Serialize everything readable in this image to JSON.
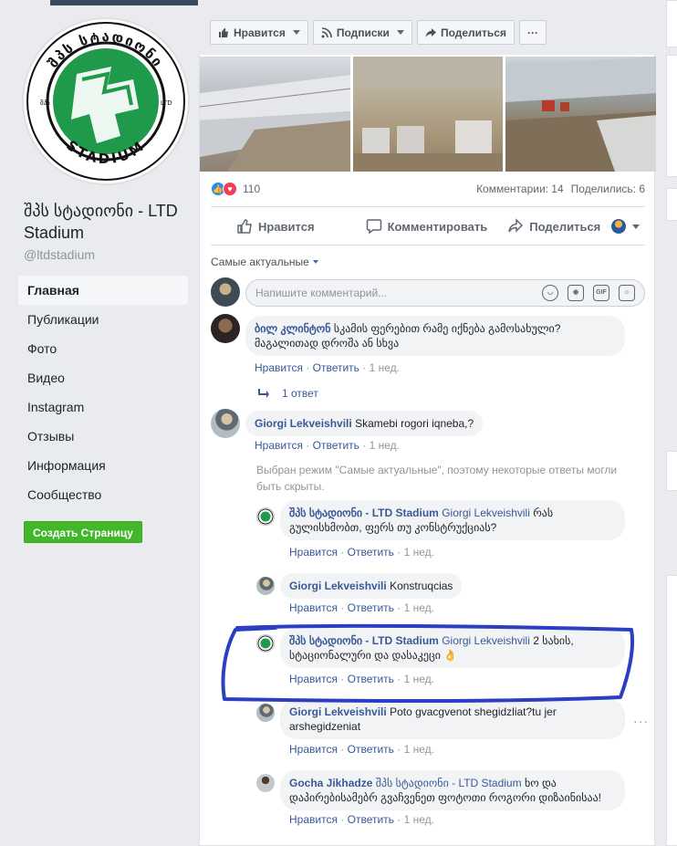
{
  "sidebar": {
    "logo_text_top": "შპს სტადიონი",
    "logo_text_bottom": "STADIUM",
    "logo_ltd_left": "შპს",
    "logo_ltd_right": "LTD",
    "page_name": "შპს სტადიონი - LTD Stadium",
    "page_handle": "@ltdstadium",
    "nav": [
      "Главная",
      "Публикации",
      "Фото",
      "Видео",
      "Instagram",
      "Отзывы",
      "Информация",
      "Сообщество"
    ],
    "create_page_label": "Создать Страницу"
  },
  "action_bar": {
    "like_label": "Нравится",
    "follow_label": "Подписки",
    "share_label": "Поделиться",
    "more_label": "···"
  },
  "post": {
    "reaction_count": "110",
    "comments_label": "Комментарии: 14",
    "shares_label": "Поделились: 6",
    "like_action": "Нравится",
    "comment_action": "Комментировать",
    "share_action": "Поделиться",
    "sort_label": "Самые актуальные",
    "compose_placeholder": "Напишите комментарий...",
    "compose_gif": "GIF"
  },
  "comments": [
    {
      "author": "ბილ კლინტონ",
      "text": "სკამის ფერებით რამე იქნება გამოსახული? მაგალითად დროშა ან სხვა",
      "time": "1 нед."
    },
    {
      "author": "Giorgi Lekveishvili",
      "text": "Skamebi rogori iqneba,?",
      "time": "1 нед."
    }
  ],
  "reply_count_label": "1 ответ",
  "notice": "Выбран режим \"Самые актуальные\", поэтому некоторые ответы могли быть скрыты.",
  "replies": [
    {
      "author": "შპს სტადიონი - LTD Stadium",
      "tag": "Giorgi Lekveishvili",
      "text": "რას გულისხმობთ, ფერს თუ კონსტრუქციას?",
      "time": "1 нед."
    },
    {
      "author": "Giorgi Lekveishvili",
      "tag": "",
      "text": "Konstruqcias",
      "time": "1 нед."
    },
    {
      "author": "შპს სტადიონი - LTD Stadium",
      "tag": "Giorgi Lekveishvili",
      "text": "2 სახის, სტაციონალური და დასაკეცი 👌",
      "time": "1 нед."
    },
    {
      "author": "Giorgi Lekveishvili",
      "tag": "",
      "text": "Poto gvacgvenot shegidzliat?tu jer arshegidzeniat",
      "time": "1 нед."
    },
    {
      "author": "Gocha Jikhadze",
      "tag": "შპს სტადიონი - LTD Stadium",
      "text": "ხო და დაპირებისამებრ გვაჩვენეთ ფოტოთი როგორი დიზაინისაა!",
      "time": "1 нед."
    }
  ],
  "labels": {
    "like": "Нравится",
    "reply": "Ответить",
    "sep": "·"
  }
}
